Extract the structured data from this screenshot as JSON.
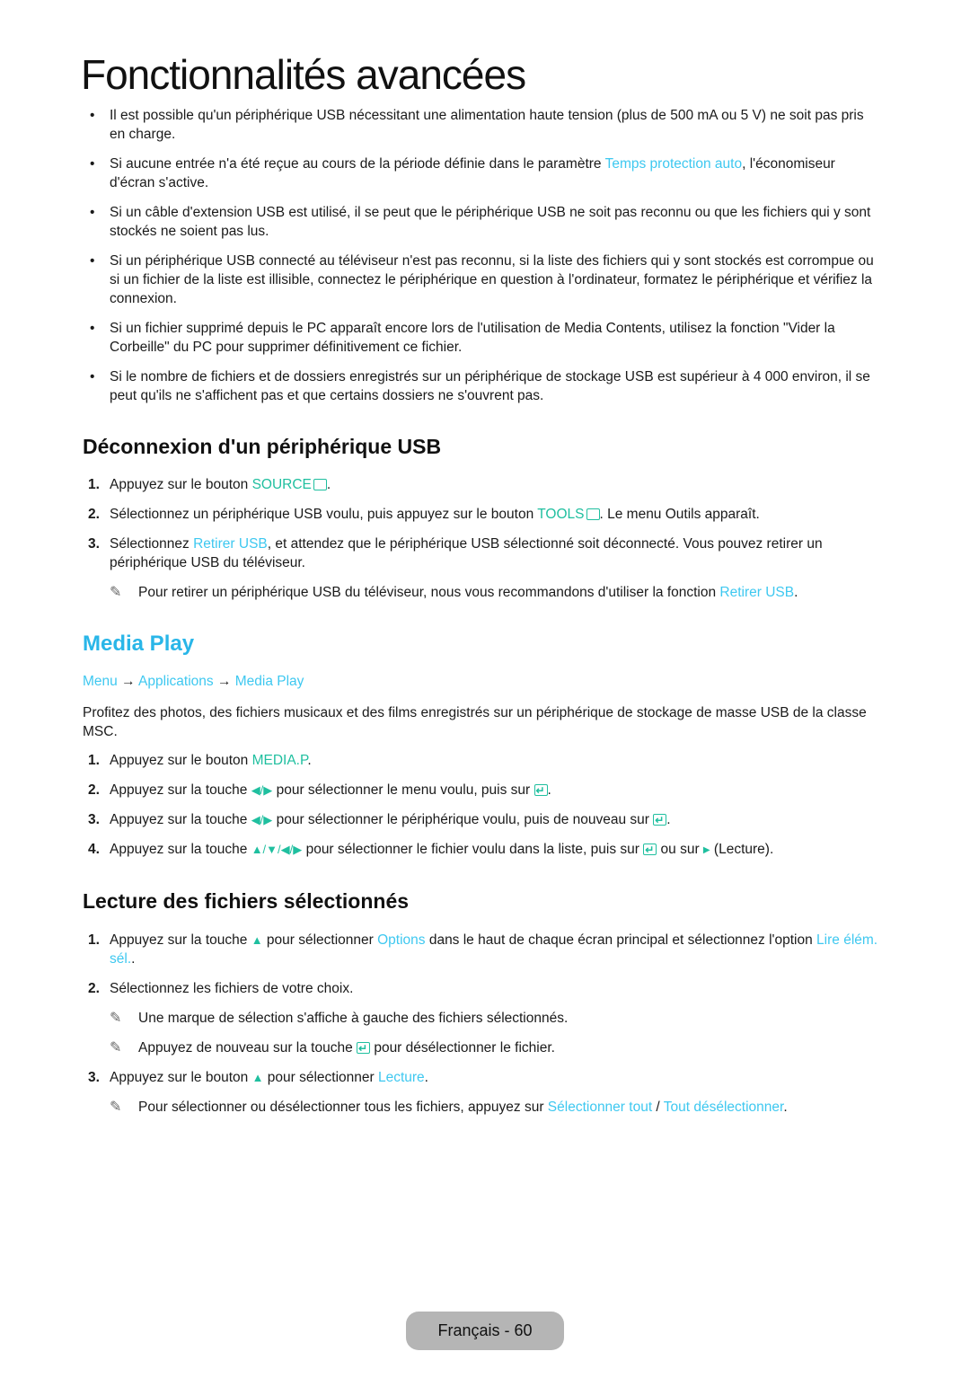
{
  "page_title": "Fonctionnalités avancées",
  "notes_list": [
    {
      "text": "Il est possible qu'un périphérique USB nécessitant une alimentation haute tension (plus de 500 mA ou 5 V) ne soit pas pris en charge."
    },
    {
      "before": "Si aucune entrée n'a été reçue au cours de la période définie dans le paramètre ",
      "link": "Temps protection auto",
      "after": ", l'économiseur d'écran s'active."
    },
    {
      "text": "Si un câble d'extension USB est utilisé, il se peut que le périphérique USB ne soit pas reconnu ou que les fichiers qui y sont stockés ne soient pas lus."
    },
    {
      "text": "Si un périphérique USB connecté au téléviseur n'est pas reconnu, si la liste des fichiers qui y sont stockés est corrompue ou si un fichier de la liste est illisible, connectez le périphérique en question à l'ordinateur, formatez le périphérique et vérifiez la connexion."
    },
    {
      "text": "Si un fichier supprimé depuis le PC apparaît encore lors de l'utilisation de Media Contents, utilisez la fonction \"Vider la Corbeille\" du PC pour supprimer définitivement ce fichier."
    },
    {
      "text": "Si le nombre de fichiers et de dossiers enregistrés sur un périphérique de stockage USB est supérieur à 4 000 environ, il se peut qu'ils ne s'affichent pas et que certains dossiers ne s'ouvrent pas."
    }
  ],
  "section_disconnect": {
    "title": "Déconnexion d'un périphérique USB",
    "steps": [
      {
        "num": "1.",
        "before": "Appuyez sur le bouton ",
        "button": "SOURCE",
        "icon": "source-icon",
        "after": "."
      },
      {
        "num": "2.",
        "before": "Sélectionnez un périphérique USB voulu, puis appuyez sur le bouton ",
        "button": "TOOLS",
        "icon": "tools-icon",
        "after": ". Le menu Outils apparaît."
      },
      {
        "num": "3.",
        "before": "Sélectionnez ",
        "link": "Retirer USB",
        "after": ", et attendez que le périphérique USB sélectionné soit déconnecté. Vous pouvez retirer un périphérique USB du téléviseur."
      }
    ],
    "note": {
      "before": "Pour retirer un périphérique USB du téléviseur, nous vous recommandons d'utiliser la fonction ",
      "link": "Retirer USB",
      "after": "."
    }
  },
  "section_media_play": {
    "title": "Media Play",
    "breadcrumb": [
      "Menu",
      "Applications",
      "Media Play"
    ],
    "breadcrumb_separator": "→",
    "intro": "Profitez des photos, des fichiers musicaux et des films enregistrés sur un périphérique de stockage de masse USB de la classe MSC.",
    "steps": [
      {
        "num": "1.",
        "before": "Appuyez sur le bouton ",
        "button": "MEDIA.P",
        "after": "."
      },
      {
        "num": "2.",
        "before": "Appuyez sur la touche ",
        "keys": "◀/▶",
        "mid": " pour sélectionner le menu voulu, puis sur ",
        "after": "."
      },
      {
        "num": "3.",
        "before": "Appuyez sur la touche ",
        "keys": "◀/▶",
        "mid": " pour sélectionner le périphérique voulu, puis de nouveau sur ",
        "after": "."
      },
      {
        "num": "4.",
        "before": "Appuyez sur la touche ",
        "keys": "▲/▼/◀/▶",
        "mid": " pour sélectionner le fichier voulu dans la liste, puis sur ",
        "mid2": " ou sur ",
        "after": " (Lecture)."
      }
    ]
  },
  "section_selected": {
    "title": "Lecture des fichiers sélectionnés",
    "step1": {
      "num": "1.",
      "before": "Appuyez sur la touche ",
      "key": "▲",
      "mid": " pour sélectionner ",
      "link": "Options",
      "mid2": " dans le haut de chaque écran principal et sélectionnez l'option ",
      "link2": "Lire élém. sél.",
      "after": "."
    },
    "step2": {
      "num": "2.",
      "text": "Sélectionnez les fichiers de votre choix."
    },
    "note1": "Une marque de sélection s'affiche à gauche des fichiers sélectionnés.",
    "note2": {
      "before": "Appuyez de nouveau sur la touche ",
      "after": " pour désélectionner le fichier."
    },
    "step3": {
      "num": "3.",
      "before": "Appuyez sur le bouton ",
      "key": "▲",
      "mid": " pour sélectionner ",
      "link": "Lecture",
      "after": "."
    },
    "note3": {
      "before": "Pour sélectionner ou désélectionner tous les fichiers, appuyez sur ",
      "link": "Sélectionner tout",
      "sep": " / ",
      "link2": "Tout désélectionner",
      "after": "."
    }
  },
  "footer": {
    "label": "Français - 60"
  },
  "icons": {
    "pencil": "✎",
    "bullet": "•"
  },
  "colors": {
    "link": "#3ec8f0",
    "button": "#1fbf9f",
    "heading_accent": "#29b6e8",
    "footer_badge": "#b5b5b5"
  }
}
